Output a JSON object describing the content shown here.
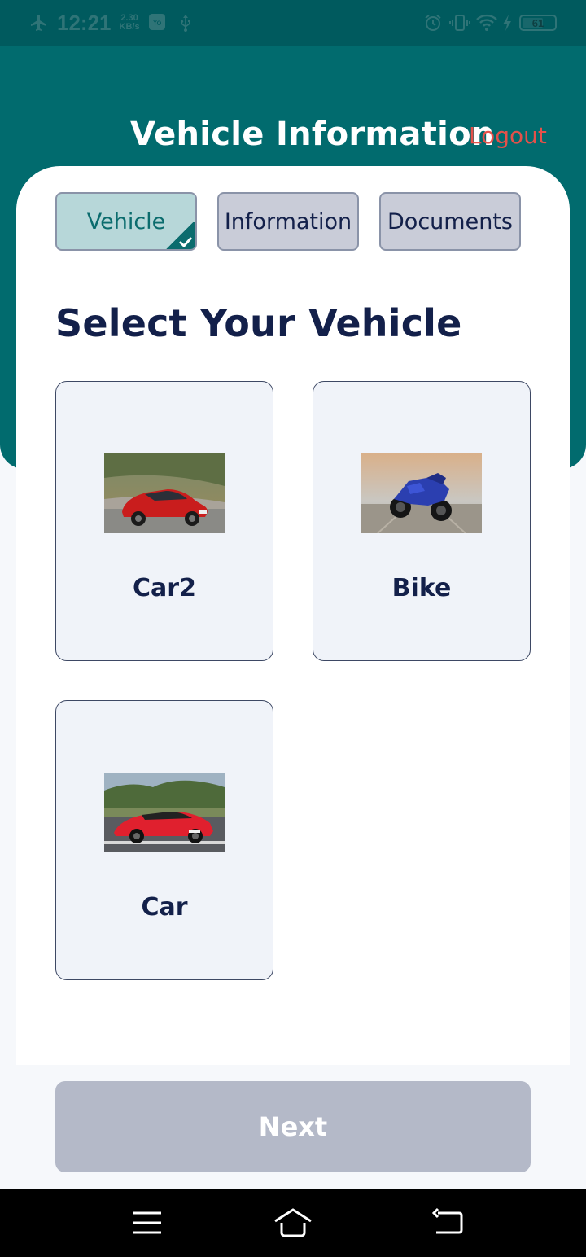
{
  "status_bar": {
    "time": "12:21",
    "speed_value": "2.30",
    "speed_unit": "KB/s",
    "battery": "61",
    "icons": [
      "airplane-icon",
      "app-notification-icon",
      "usb-icon",
      "alarm-icon",
      "vibrate-icon",
      "wifi-icon",
      "charging-icon",
      "battery-icon"
    ]
  },
  "header": {
    "title": "Vehicle Information",
    "logout_label": "Logout"
  },
  "tabs": [
    {
      "label": "Vehicle",
      "active": true,
      "completed": true
    },
    {
      "label": "Information",
      "active": false
    },
    {
      "label": "Documents",
      "active": false
    }
  ],
  "main": {
    "section_title": "Select Your Vehicle",
    "vehicles": [
      {
        "name": "Car2",
        "image": "red-sports-sedan"
      },
      {
        "name": "Bike",
        "image": "blue-sport-motorcycle"
      },
      {
        "name": "Car",
        "image": "red-supercar"
      }
    ]
  },
  "footer": {
    "next_label": "Next"
  },
  "nav": [
    "menu-icon",
    "home-icon",
    "back-icon"
  ],
  "colors": {
    "primary": "#016b6e",
    "logout": "#e4514a",
    "text_dark": "#13204a",
    "button_disabled": "#b4b9c8"
  }
}
